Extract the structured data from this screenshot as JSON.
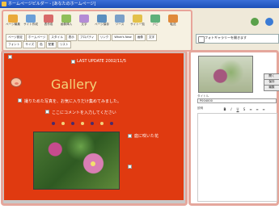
{
  "window": {
    "title": "ホームページビルダー - [あなたのホームページ]"
  },
  "toolbar": {
    "buttons": [
      {
        "label": "ページ編集"
      },
      {
        "label": "サイト作成"
      },
      {
        "label": "表作成"
      },
      {
        "label": "画像挿入"
      },
      {
        "label": "文字"
      },
      {
        "label": "ページ保存"
      },
      {
        "label": "ソース"
      },
      {
        "label": "サイト一覧"
      },
      {
        "label": "ナビ"
      },
      {
        "label": "転送"
      }
    ],
    "tabs_row1": [
      "ページ設定",
      "ホームページ",
      "スタイル",
      "表示",
      "プロパティ",
      "リンク",
      "What's New",
      "画像",
      "文字"
    ],
    "tabs_row2": [
      "フォント",
      "サイズ",
      "色",
      "配置",
      "リスト"
    ],
    "search_placeholder": "フォトギャラリーを開きます"
  },
  "canvas": {
    "last_update": "LAST UPDATE 2002/11/5",
    "gallery_title": "Gallery",
    "line1": "撮りためた写真を、お気に入りだけ集めてみました。",
    "line2": "ここにコメントを入力してください",
    "photo_caption": "庭に咲いた花"
  },
  "right_panel": {
    "btn_open": "開く",
    "btn_save": "保存",
    "btn_edit": "編集",
    "label_title": "タイトル",
    "field_title": "P004000",
    "label_comment": "説明",
    "format_buttons": [
      "B",
      "I",
      "U",
      "S",
      "≡",
      "≡",
      "≡"
    ]
  }
}
